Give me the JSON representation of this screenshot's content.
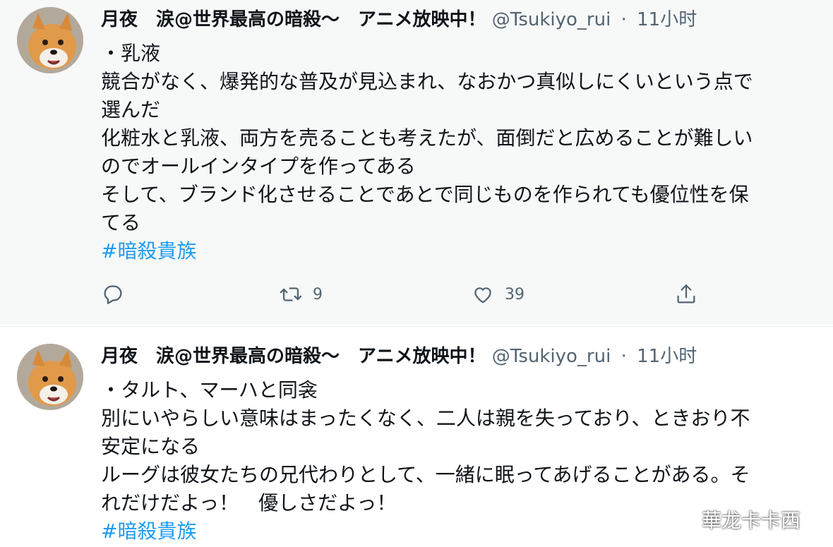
{
  "tweets": [
    {
      "display_name": "月夜　涙@世界最高の暗殺～　アニメ放映中！",
      "handle": "@Tsukiyo_rui",
      "separator": "·",
      "time": "11小时",
      "lines": [
        "・乳液",
        "競合がなく、爆発的な普及が見込まれ、なおかつ真似しにくいという点で",
        "選んだ",
        "化粧水と乳液、両方を売ることも考えたが、面倒だと広めることが難しい",
        "のでオールインタイプを作ってある",
        "そして、ブランド化させることであとで同じものを作られても優位性を保",
        "てる"
      ],
      "hashtag": "#暗殺貴族",
      "retweet_count": "9",
      "like_count": "39"
    },
    {
      "display_name": "月夜　涙@世界最高の暗殺～　アニメ放映中！",
      "handle": "@Tsukiyo_rui",
      "separator": "·",
      "time": "11小时",
      "lines": [
        "・タルト、マーハと同衾",
        "別にいやらしい意味はまったくなく、二人は親を失っており、ときおり不",
        "安定になる",
        "ルーグは彼女たちの兄代わりとして、一緒に眠ってあげることがある。そ",
        "れだけだよっ！　優しさだよっ！"
      ],
      "hashtag": "#暗殺貴族"
    }
  ],
  "watermark": "華龙卡卡西",
  "colors": {
    "link": "#1d9bf0",
    "secondary_text": "#536471",
    "highlight_bg": "#f7f9f9"
  },
  "icons": [
    "reply-icon",
    "retweet-icon",
    "like-icon",
    "share-icon"
  ]
}
